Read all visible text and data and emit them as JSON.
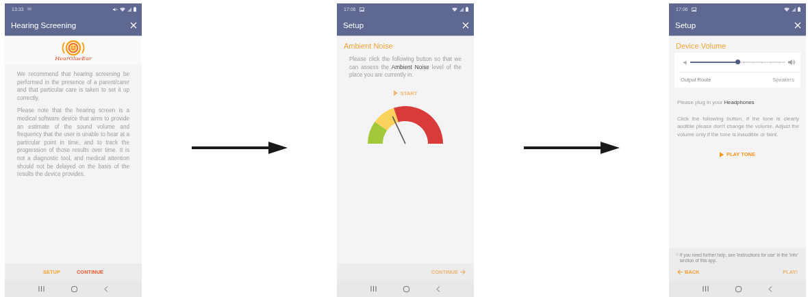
{
  "screens": [
    {
      "kind": "intro",
      "status_bar": {
        "time": "13:33",
        "icons": [
          {
            "kind": "lines"
          },
          {
            "kind": "mute"
          },
          {
            "kind": "wifi"
          },
          {
            "kind": "signal"
          },
          {
            "kind": "battery"
          }
        ]
      },
      "title": "Hearing Screening",
      "logo_text": "HearGlueEar",
      "paragraphs": [
        "We recommend that hearing screening be performed in the presence of a parent/carer and that particular care is taken to set it up correctly.",
        "Please note that the hearing screen is a medical software device that aims to provide an estimate of the sound volume and frequency that the user is unable to hear at a particular point in time, and to track the progression of those results over time. It is not a diagnostic tool, and medical attention should not be delayed on the basis of the results the device provides."
      ],
      "footer_buttons": [
        {
          "label": "SETUP",
          "kind": "plain",
          "disabled": false
        },
        {
          "label": "CONTINUE",
          "kind": "primary",
          "disabled": false
        }
      ]
    },
    {
      "kind": "ambient",
      "status_bar": {
        "time": "17:06",
        "icons": [
          {
            "kind": "image"
          },
          {
            "kind": "wifi"
          },
          {
            "kind": "signal"
          },
          {
            "kind": "battery"
          }
        ]
      },
      "title": "Setup",
      "heading": "Ambient Noise",
      "paragraphs": [
        "Please click the following button so that we can assess the **Ambient Noise** level of the place you are currently in."
      ],
      "action": {
        "label": "START",
        "disabled": true
      },
      "gauge": {
        "level": 0.36
      },
      "footer_buttons": [
        {
          "label": "CONTINUE",
          "kind": "forward",
          "disabled": true
        }
      ]
    },
    {
      "kind": "volume",
      "status_bar": {
        "time": "17:06",
        "icons": [
          {
            "kind": "image"
          },
          {
            "kind": "wifi"
          },
          {
            "kind": "signal"
          },
          {
            "kind": "battery"
          }
        ]
      },
      "title": "Setup",
      "heading": "Device Volume",
      "volume": {
        "level": 0.5
      },
      "output_route": {
        "label": "Output Route",
        "value": "Speakers"
      },
      "paragraphs": [
        "Please plug in your **Headphones**",
        "Click the following button, if the tone is clearly audible please don't change the volume. Adjust the volume only if the tone is inaudible or faint."
      ],
      "action": {
        "label": "PLAY TONE",
        "disabled": false
      },
      "help_note": "If you need further help, see 'instructions for use' in the 'Info' section of this app.",
      "footer_buttons": [
        {
          "label": "BACK",
          "kind": "back",
          "disabled": false
        },
        {
          "label": "PLAY!",
          "kind": "plain",
          "disabled": true
        }
      ]
    }
  ]
}
